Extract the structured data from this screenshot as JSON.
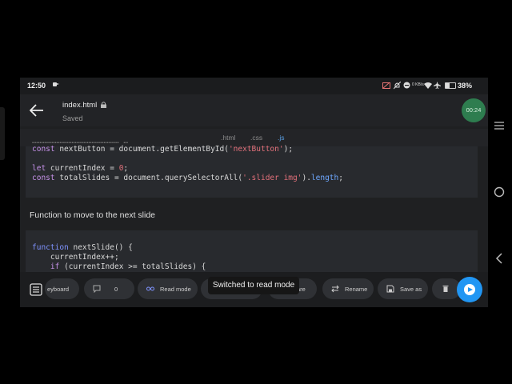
{
  "status": {
    "time": "12:50",
    "battery_pct": "38%",
    "battery_level": 0.38,
    "speed": "0 KB/s"
  },
  "appbar": {
    "filename": "index.html",
    "subtitle": "Saved",
    "timer": "00:24"
  },
  "tabs": [
    {
      "label": ".html"
    },
    {
      "label": ".css"
    },
    {
      "label": ".js",
      "active": true
    }
  ],
  "code1": {
    "line1": {
      "kw": "const",
      "a": " nextButton = document.getElementById(",
      "str": "'nextButton'",
      "b": ");"
    },
    "line2": {
      "kw": "let",
      "a": " currentIndex = ",
      "num": "0",
      "b": ";"
    },
    "line3": {
      "kw": "const",
      "a": " totalSlides = document.querySelectorAll(",
      "str": "'.slider img'",
      "b": ").",
      "prop": "length",
      "c": ";"
    }
  },
  "comment": "Function to move to the next slide",
  "code2": {
    "line1": {
      "kw": "function",
      "a": " nextSlide() {"
    },
    "line2": {
      "a": "    currentIndex++;"
    },
    "line3": {
      "kw": "if",
      "a": " (currentIndex >= totalSlides) {"
    }
  },
  "toolbar": {
    "keyboard": "eyboard",
    "count": "0",
    "read_mode": "Read mode",
    "share": "are",
    "rename": "Rename",
    "save_as": "Save as"
  },
  "toast": "Switched to read mode",
  "colors": {
    "accent": "#2196f3",
    "timer": "#2e7d4f",
    "tab_active": "#5aa0e6"
  }
}
